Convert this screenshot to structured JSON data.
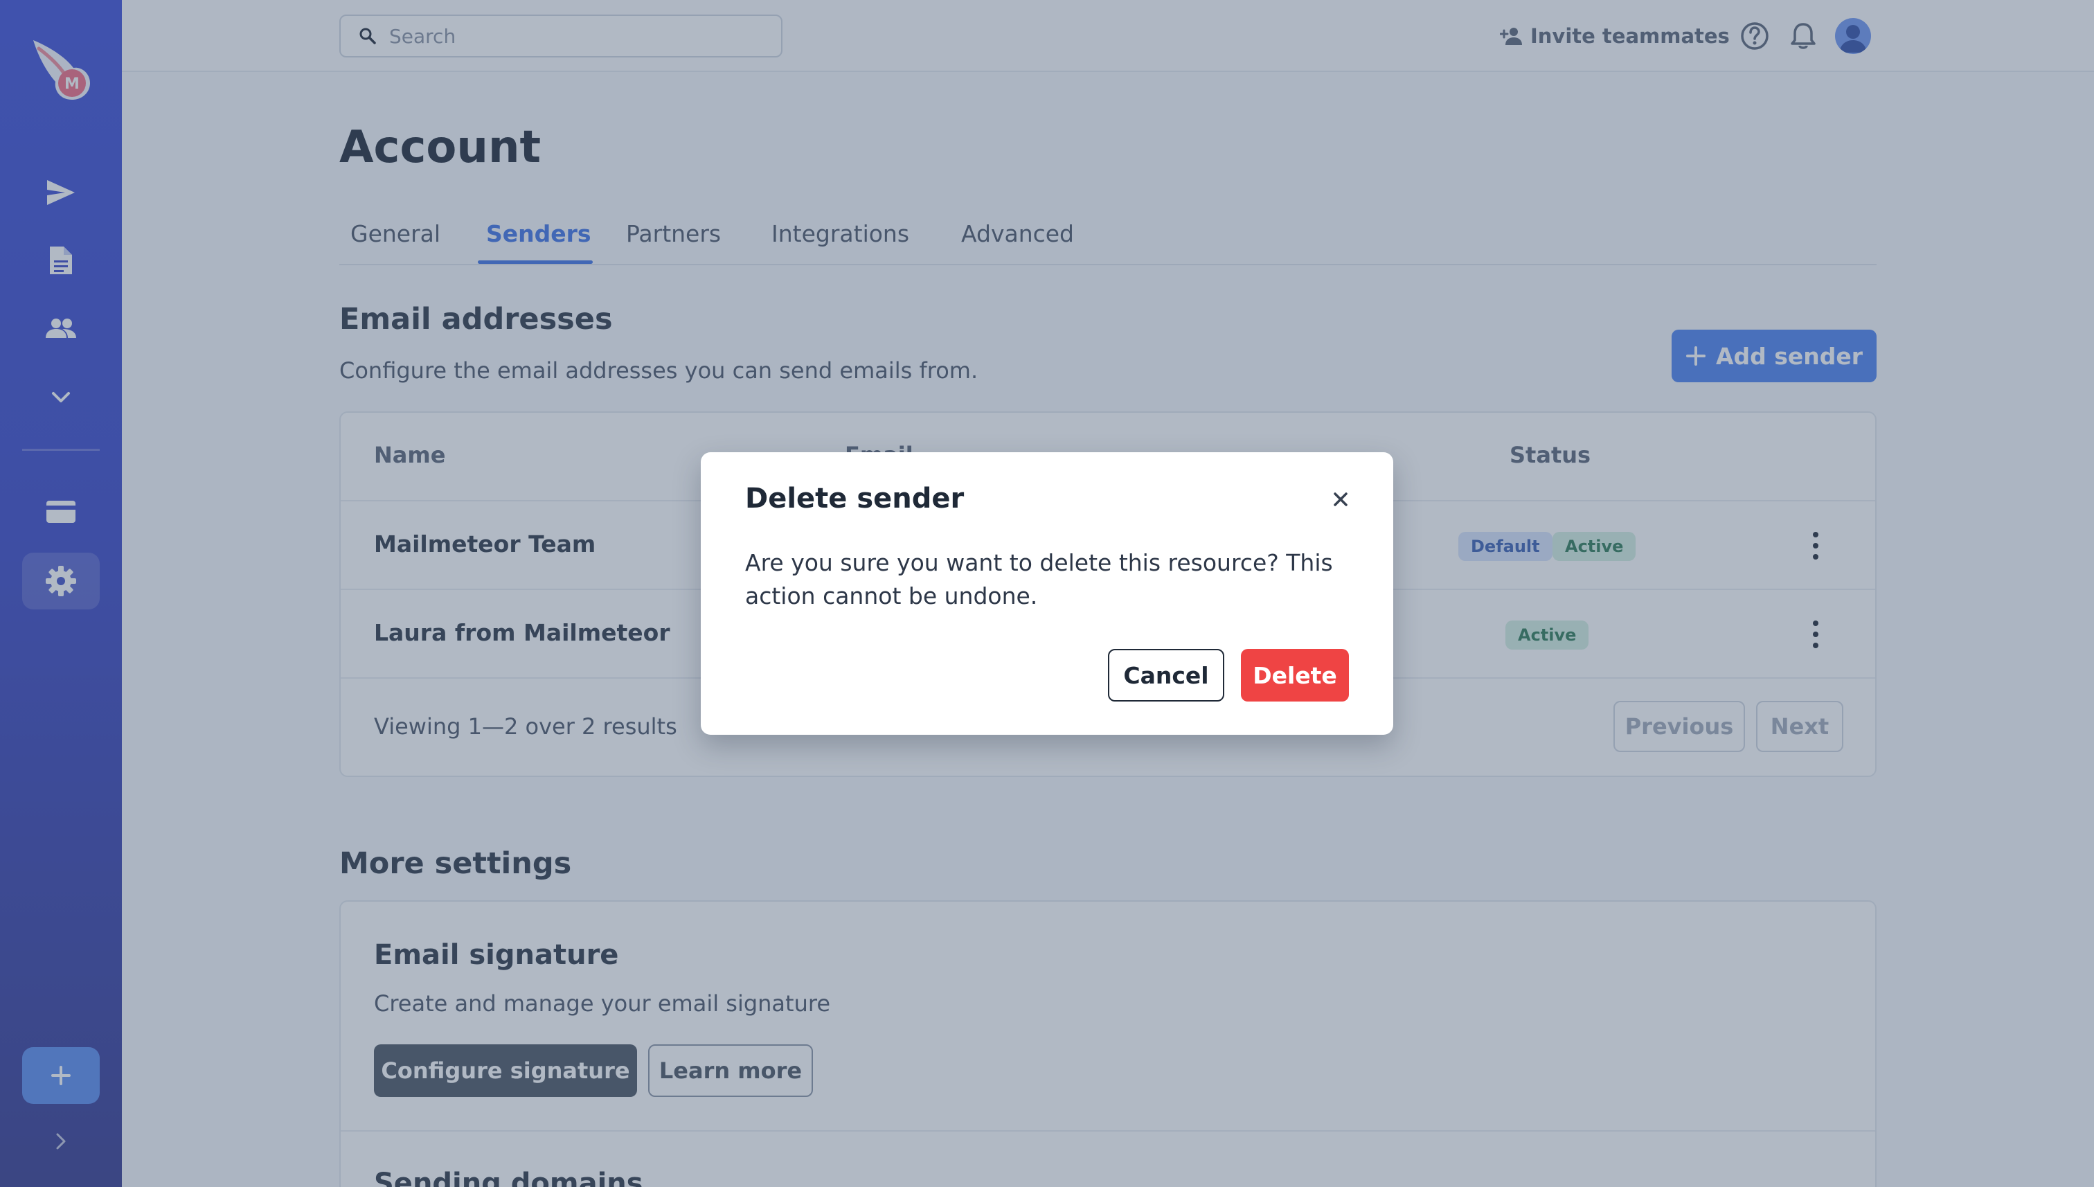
{
  "app": {
    "logo_letter": "M"
  },
  "sidebar": {
    "items": [
      {
        "icon": "send-icon"
      },
      {
        "icon": "document-icon"
      },
      {
        "icon": "people-icon"
      },
      {
        "icon": "chevron-down-icon"
      },
      {
        "icon": "credit-card-icon"
      },
      {
        "icon": "gear-icon",
        "active": true
      }
    ],
    "compose_icon": "plus-icon",
    "expand_icon": "chevron-right-icon"
  },
  "topbar": {
    "search_placeholder": "Search",
    "invite_label": "Invite teammates"
  },
  "page": {
    "title": "Account",
    "tabs": [
      {
        "label": "General"
      },
      {
        "label": "Senders",
        "active": true
      },
      {
        "label": "Partners"
      },
      {
        "label": "Integrations"
      },
      {
        "label": "Advanced"
      }
    ]
  },
  "email_section": {
    "title": "Email addresses",
    "description": "Configure the email addresses you can send emails from.",
    "add_button": "Add sender",
    "columns": {
      "name": "Name",
      "email": "Email",
      "status": "Status"
    },
    "rows": [
      {
        "name": "Mailmeteor Team",
        "badges": [
          "Default",
          "Active"
        ]
      },
      {
        "name": "Laura from Mailmeteor",
        "badges": [
          "Active"
        ]
      }
    ],
    "footer_text": "Viewing 1—2 over 2 results",
    "previous": "Previous",
    "next": "Next"
  },
  "more_settings": {
    "title": "More settings",
    "signature_title": "Email signature",
    "signature_desc": "Create and manage your email signature",
    "configure_button": "Configure signature",
    "learn_more_button": "Learn more",
    "domains_title": "Sending domains"
  },
  "modal": {
    "title": "Delete sender",
    "body": "Are you sure you want to delete this resource? This action cannot be undone.",
    "cancel": "Cancel",
    "delete": "Delete"
  },
  "colors": {
    "accent": "#3f73e6",
    "danger": "#ef4444",
    "sidebar": "#3d4fd8"
  }
}
